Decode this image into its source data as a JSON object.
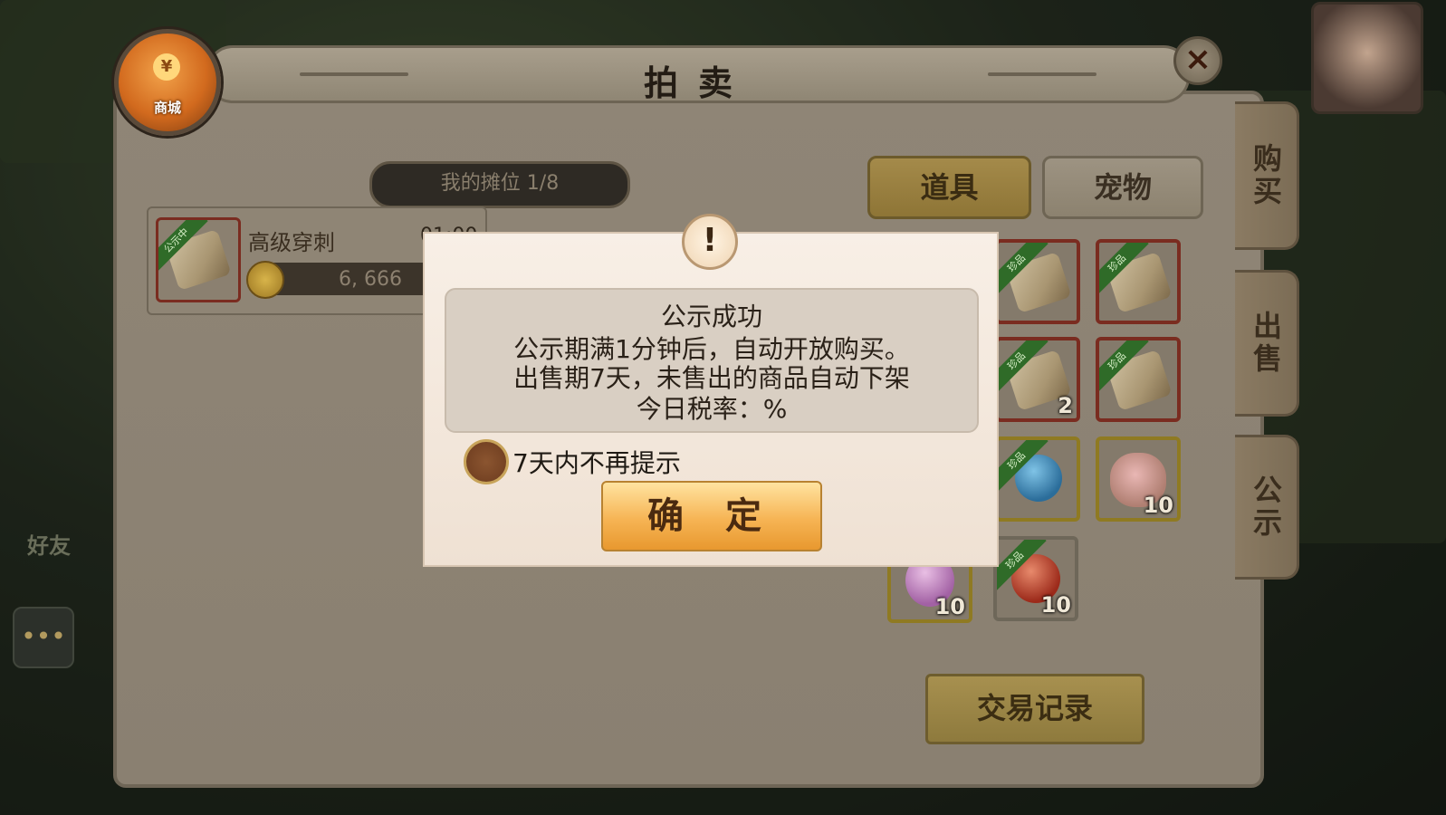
{
  "mall": {
    "label": "商城",
    "coin_symbol": "¥"
  },
  "header": {
    "title": "拍卖"
  },
  "stall": {
    "label": "我的摊位 1/8"
  },
  "tabs": {
    "items": "道具",
    "pets": "宠物"
  },
  "side_tabs": {
    "buy": "购买",
    "sell": "出售",
    "public": "公示"
  },
  "listing": {
    "name": "高级穿刺",
    "time": "01:00",
    "price": "6, 666",
    "badge": "公示中"
  },
  "inventory": [
    {
      "badge": "珍品",
      "count": ""
    },
    {
      "badge": "珍品",
      "count": ""
    },
    {
      "badge": "珍品",
      "count": "2"
    },
    {
      "badge": "珍品",
      "count": ""
    },
    {
      "badge": "珍品",
      "count": ""
    },
    {
      "badge": "",
      "count": "10"
    },
    {
      "badge": "",
      "count": "10"
    },
    {
      "badge": "珍品",
      "count": "10"
    }
  ],
  "trade_button": "交易记录",
  "friend_label": "好友",
  "modal": {
    "alert_icon": "!",
    "title": "公示成功",
    "line1": "公示期满1分钟后，自动开放购买。",
    "line2": "出售期7天，未售出的商品自动下架",
    "line3": "今日税率：%",
    "checkbox_label": "7天内不再提示",
    "confirm": "确 定"
  }
}
